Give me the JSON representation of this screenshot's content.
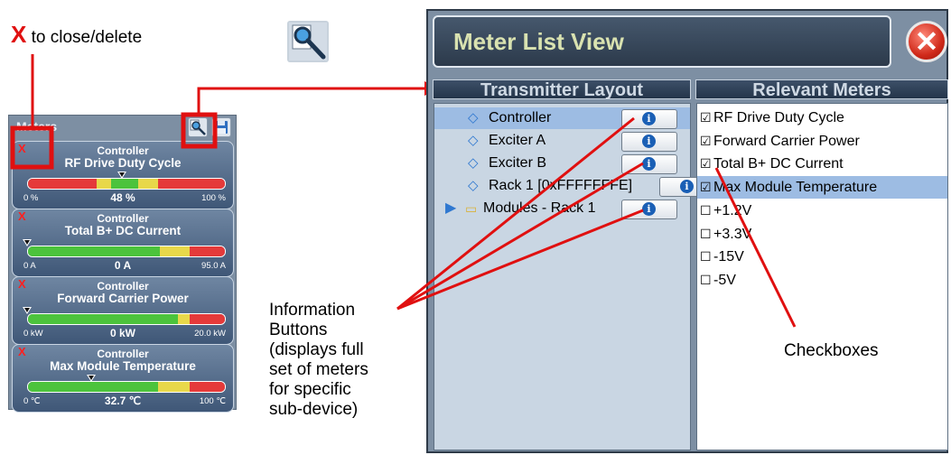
{
  "annotations": {
    "close_x": "X",
    "close_text": "to close/delete",
    "info_buttons": [
      "Information",
      "Buttons",
      "(displays full",
      "set of meters",
      "for specific",
      "sub-device)"
    ],
    "checkboxes": "Checkboxes"
  },
  "meters_panel": {
    "title": "Meters",
    "cards": [
      {
        "device": "Controller",
        "name": "RF Drive Duty Cycle",
        "min": "0 %",
        "value": "48 %",
        "max": "100 %",
        "level": 0.48
      },
      {
        "device": "Controller",
        "name": "Total B+ DC Current",
        "min": "0 A",
        "value": "0 A",
        "max": "95.0 A",
        "level": 0.0
      },
      {
        "device": "Controller",
        "name": "Forward Carrier Power",
        "min": "0 kW",
        "value": "0 kW",
        "max": "20.0 kW",
        "level": 0.0
      },
      {
        "device": "Controller",
        "name": "Max Module Temperature",
        "min": "0 ℃",
        "value": "32.7 ℃",
        "max": "100 ℃",
        "level": 0.327
      }
    ],
    "remove_icon": "X"
  },
  "view": {
    "title": "Meter List View",
    "close_icon": "close-icon",
    "left_header": "Transmitter Layout",
    "right_header": "Relevant Meters",
    "layout_items": [
      {
        "label": "Controller",
        "selected": true
      },
      {
        "label": "Exciter A",
        "selected": false
      },
      {
        "label": "Exciter B",
        "selected": false
      },
      {
        "label": "Rack 1 [0xFFFFFFFE]",
        "selected": false
      },
      {
        "label": "Modules - Rack 1",
        "selected": false
      }
    ],
    "meters": [
      {
        "label": "RF Drive Duty Cycle",
        "checked": true
      },
      {
        "label": "Forward Carrier Power",
        "checked": true
      },
      {
        "label": "Total B+ DC Current",
        "checked": true
      },
      {
        "label": "Max Module Temperature",
        "checked": true
      },
      {
        "label": "+1.2V",
        "checked": false
      },
      {
        "label": "+3.3V",
        "checked": false
      },
      {
        "label": "-15V",
        "checked": false
      },
      {
        "label": "-5V",
        "checked": false
      }
    ]
  },
  "colors": {
    "annotation_red": "#e01010",
    "panel_bg": "#7d8fa3",
    "selection": "#9dbce3",
    "info_blue": "#1a5fb5"
  }
}
